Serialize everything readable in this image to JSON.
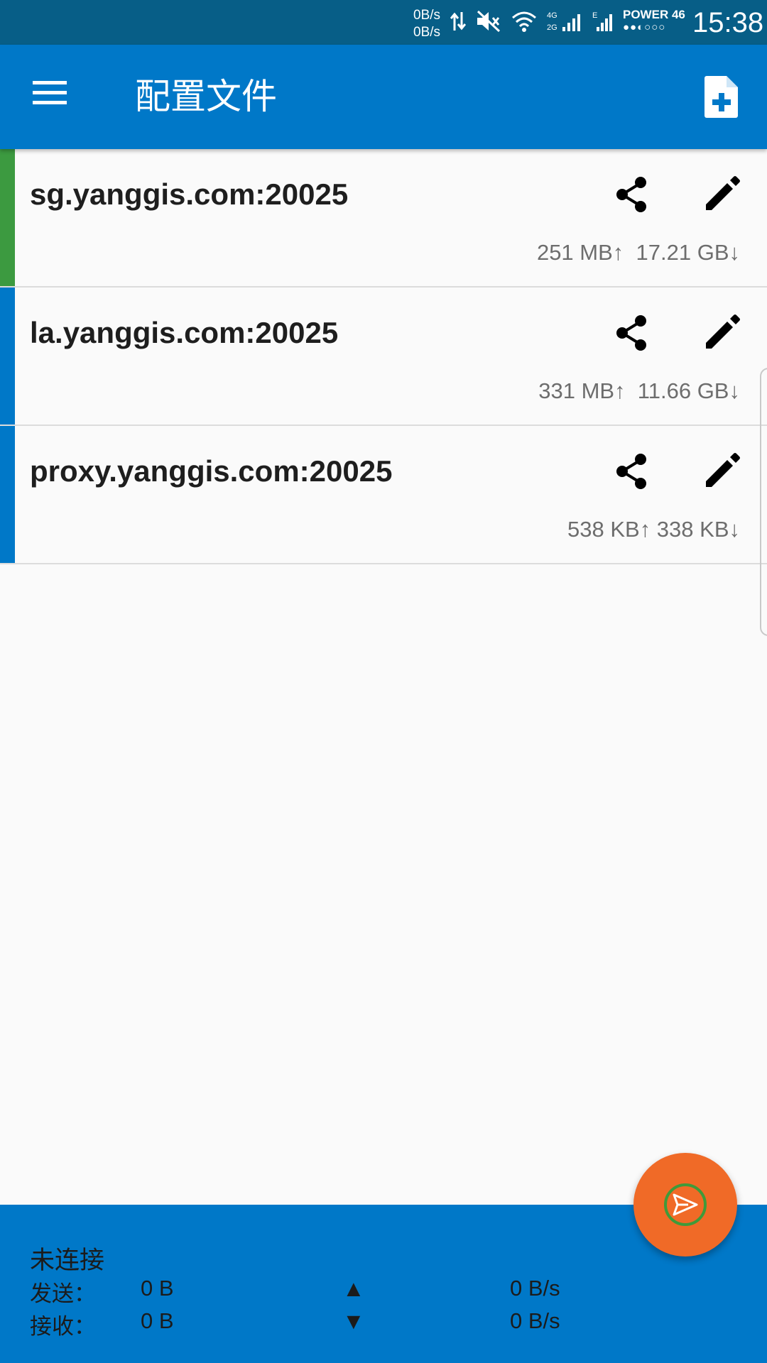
{
  "status_bar": {
    "speed_up": "0B/s",
    "speed_down": "0B/s",
    "icons": [
      "data-arrows-icon",
      "mute-icon",
      "wifi-icon",
      "signal-4g-icon",
      "signal-2g-e-icon",
      "signal-icon"
    ],
    "carrier": "POWER 46",
    "carrier_dots": "●●◐○○○",
    "time": "15:38"
  },
  "appbar": {
    "title": "配置文件",
    "menu_icon": "menu-icon",
    "add_icon": "add-profile-icon"
  },
  "profiles": [
    {
      "host": "sg.yanggis.com:20025",
      "traffic": "251 MB↑  17.21 GB↓",
      "bar_color": "#3c9a40"
    },
    {
      "host": "la.yanggis.com:20025",
      "traffic": "331 MB↑  11.66 GB↓",
      "bar_color": "#0078c8"
    },
    {
      "host": "proxy.yanggis.com:20025",
      "traffic": "538 KB↑ 338 KB↓",
      "bar_color": "#0078c8"
    }
  ],
  "bottom_panel": {
    "state": "未连接",
    "send": {
      "label": "发送：",
      "total": "0 B",
      "arrow": "▲",
      "rate": "0 B/s"
    },
    "receive": {
      "label": "接收：",
      "total": "0 B",
      "arrow": "▼",
      "rate": "0 B/s"
    }
  },
  "fab": {
    "icon": "send-icon",
    "color": "#f06a27"
  },
  "colors": {
    "primary": "#0078c8",
    "status_bar": "#075e87",
    "accent": "#f06a27",
    "active": "#3c9a40"
  }
}
